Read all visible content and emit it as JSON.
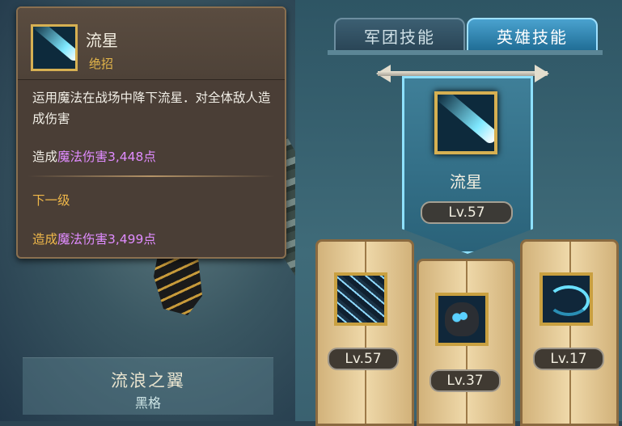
{
  "tooltip": {
    "title": "流星",
    "type": "绝招",
    "description": "运用魔法在战场中降下流星．对全体敌人造成伤害",
    "current": {
      "prefix": "造成",
      "effect": "魔法伤害3,448点"
    },
    "next_level_label": "下一级",
    "next": {
      "prefix": "造成",
      "effect": "魔法伤害3,499点"
    },
    "icon": "meteor-skill-icon"
  },
  "character": {
    "name": "流浪之翼",
    "subtitle": "黑格"
  },
  "tabs": {
    "army": "军团技能",
    "hero": "英雄技能"
  },
  "featured_skill": {
    "name": "流星",
    "level": "Lv.57",
    "icon": "meteor-skill-icon"
  },
  "skills": [
    {
      "level": "Lv.57",
      "icon": "feather-burst-icon"
    },
    {
      "level": "Lv.37",
      "icon": "owl-icon"
    },
    {
      "level": "Lv.17",
      "icon": "wind-swirl-icon"
    }
  ],
  "colors": {
    "damage": "#e08cff",
    "next_level": "#f0b84a",
    "active_tab": "#1e6b93",
    "glow": "#8ee1ff"
  }
}
